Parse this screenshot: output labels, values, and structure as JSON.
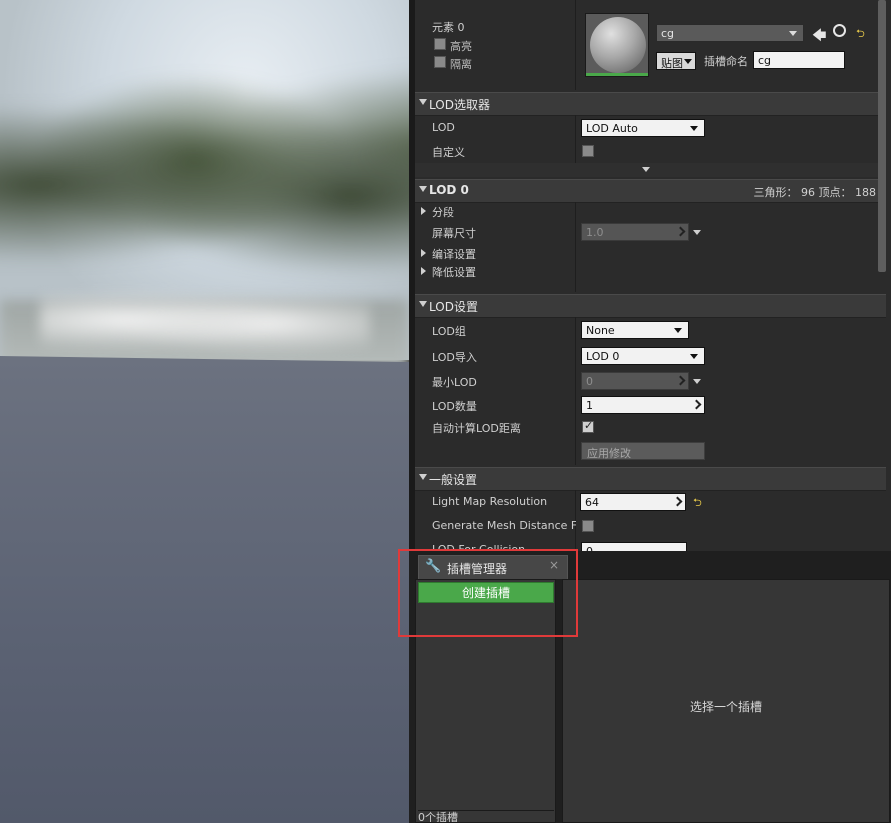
{
  "material_slot": {
    "element_label": "元素 0",
    "highlight_label": "高亮",
    "isolate_label": "隔离",
    "material_name": "cg",
    "texture_button": "贴图",
    "slot_name_label": "插槽命名",
    "slot_name_value": "cg"
  },
  "lod_picker": {
    "title": "LOD选取器",
    "lod_label": "LOD",
    "lod_value": "LOD Auto",
    "custom_label": "自定义"
  },
  "lod0": {
    "title": "LOD 0",
    "stats": "三角形： 96   顶点： 188",
    "sections_label": "分段",
    "screen_size_label": "屏幕尺寸",
    "screen_size_value": "1.0",
    "build_settings_label": "编译设置",
    "reduction_settings_label": "降低设置"
  },
  "lod_settings": {
    "title": "LOD设置",
    "lod_group_label": "LOD组",
    "lod_group_value": "None",
    "lod_import_label": "LOD导入",
    "lod_import_value": "LOD 0",
    "min_lod_label": "最小LOD",
    "min_lod_value": "0",
    "lod_count_label": "LOD数量",
    "lod_count_value": "1",
    "auto_compute_label": "自动计算LOD距离",
    "auto_compute_checked": true,
    "apply_button": "应用修改"
  },
  "general_settings": {
    "title": "一般设置",
    "light_map_label": "Light Map Resolution",
    "light_map_value": "64",
    "mesh_distance_label": "Generate Mesh Distance Fiel",
    "lod_collision_label": "LOD For Collision",
    "lod_collision_value": "0"
  },
  "socket_manager": {
    "tab_title": "插槽管理器",
    "close": "×",
    "create_button": "创建插槽",
    "empty_message": "选择一个插槽",
    "socket_count": "0个插槽"
  },
  "colors": {
    "accent_green": "#4aa84a",
    "highlight_red": "#e03a3a",
    "reset_yellow": "#e6c84a"
  }
}
